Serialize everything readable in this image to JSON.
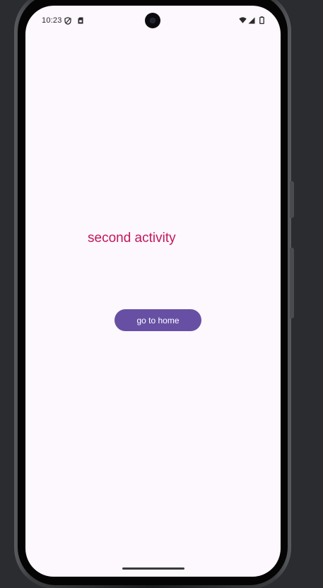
{
  "status_bar": {
    "time": "10:23",
    "icons": [
      "vpn-shield-icon",
      "sim-card-icon",
      "wifi-icon",
      "cell-signal-icon",
      "battery-icon"
    ]
  },
  "activity": {
    "label": "second activity",
    "label_color": "#c2185b"
  },
  "home_button": {
    "label": "go to home",
    "color": "#6750a4"
  },
  "colors": {
    "screen_background": "#fdf7fe",
    "desktop_background": "#2b2c30"
  }
}
